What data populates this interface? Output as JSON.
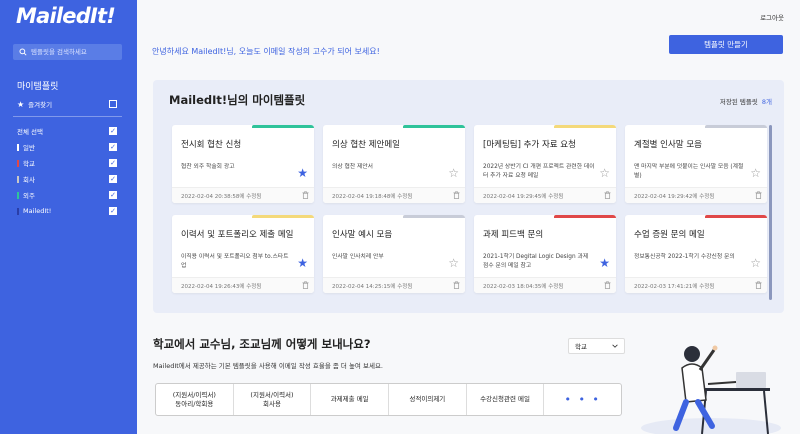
{
  "app": {
    "logo": "MailedIt!"
  },
  "sidebar": {
    "search_placeholder": "템플릿을 검색하세요",
    "title": "마이템플릿",
    "favorites_label": "즐겨찾기",
    "select_all_label": "전체 선택",
    "categories": [
      {
        "label": "일반",
        "color": "#3e63e0"
      },
      {
        "label": "학교",
        "color": "#e04848"
      },
      {
        "label": "회사",
        "color": "#c8c8c8"
      },
      {
        "label": "외주",
        "color": "#2fc39a"
      },
      {
        "label": "MailedIt!",
        "color": "#2a3ea8"
      }
    ]
  },
  "header": {
    "logout": "로그아웃",
    "welcome": "안녕하세요 MailedIt!님, 오늘도 이메일 작성의 고수가 되어 보세요!",
    "make_template": "템플릿 만들기"
  },
  "panel": {
    "title": "MailedIt!님의 마이템플릿",
    "saved_label": "저장된 템플릿",
    "saved_count": "8개",
    "cards": [
      {
        "title": "전시회 협찬 신청",
        "desc": "협찬 외주 학술회 광고",
        "date": "2022-02-04 20:38:58에 수정됨",
        "starred": true,
        "accent": "#2fc39a"
      },
      {
        "title": "의상 협찬 제안메일",
        "desc": "의상 협찬 제안서",
        "date": "2022-02-04 19:18:48에 수정됨",
        "starred": false,
        "accent": "#2fc39a"
      },
      {
        "title": "[마케팅팀] 추가 자료 요청",
        "desc": "2022년 상반기 CI 개편 프로젝트 관련한 데이터 추가 자료 요청 메일",
        "date": "2022-02-04 19:29:45에 수정됨",
        "starred": false,
        "accent": "#f4d97a"
      },
      {
        "title": "계절별 인사말 모음",
        "desc": "맨 마지막 부분에 덧붙이는 인사말 모음 (계절별)",
        "date": "2022-02-04 19:29:42에 수정됨",
        "starred": false,
        "accent": "#c8ccd8"
      },
      {
        "title": "이력서 및 포트폴리오 제출 메일",
        "desc": "이직용 이력서 및 포트폴리오 첨부 to.스타트업",
        "date": "2022-02-04 19:26:43에 수정됨",
        "starred": true,
        "accent": "#f4d97a"
      },
      {
        "title": "인사말 예시 모음",
        "desc": "인사말 인사치레 안부",
        "date": "2022-02-04 14:25:15에 수정됨",
        "starred": false,
        "accent": "#c8ccd8"
      },
      {
        "title": "과제 피드백 문의",
        "desc": "2021-1학기 Degital Logic Design 과제 점수 문의 메일 참고",
        "date": "2022-02-03 18:04:35에 수정됨",
        "starred": true,
        "accent": "#e04848"
      },
      {
        "title": "수업 증원 문의 메일",
        "desc": "정보통신공학 2022-1학기 수강신청 문의",
        "date": "2022-02-03 17:41:21에 수정됨",
        "starred": false,
        "accent": "#e04848"
      }
    ]
  },
  "section": {
    "title": "학교에서 교수님, 조교님께 어떻게 보내나요?",
    "subtitle": "MailedIt에서 제공하는 기본 템플릿을 사용해 이메일 작성 효율을 좀 더 높여 보세요.",
    "select_value": "학교",
    "tabs": [
      "(지원서/이력서)\n동아리/학회용",
      "(지원서/이력서)\n회사용",
      "과제제출 메일",
      "성적이의제기",
      "수강신청관련 메일",
      "• • •"
    ]
  },
  "colors": {
    "accent": "#3e63e0",
    "star": "#3e63e0"
  }
}
